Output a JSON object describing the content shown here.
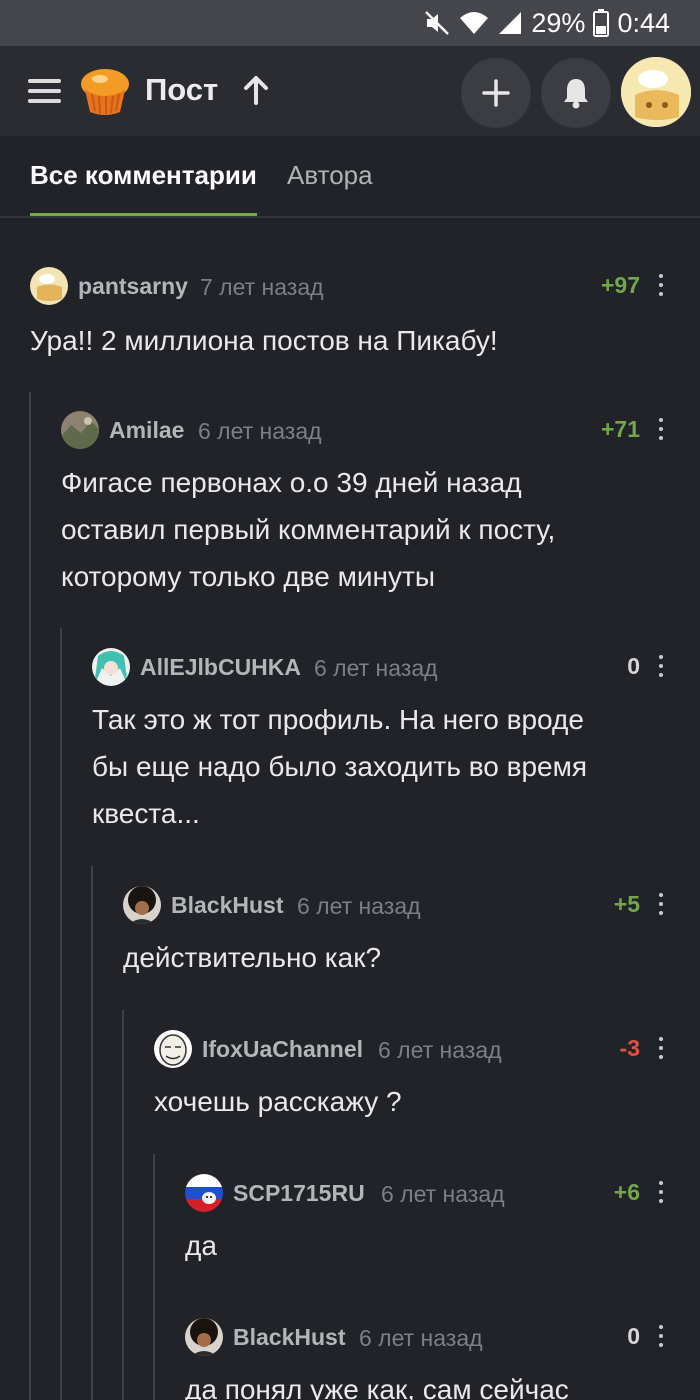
{
  "status_bar": {
    "battery": "29%",
    "time": "0:44"
  },
  "header": {
    "title": "Пост"
  },
  "tabs": [
    {
      "label": "Все комментарии"
    },
    {
      "label": "Автора"
    }
  ],
  "comments": [
    {
      "author": "pantsarny",
      "time": "7 лет назад",
      "rating": "+97",
      "text": "Ура!! 2 миллиона постов на Пикабу!"
    },
    {
      "author": "Amilae",
      "time": "6 лет назад",
      "rating": "+71",
      "text": "Фигасе первонах о.о 39 дней назад\nоставил первый комментарий к посту,\nкоторому только две минуты"
    },
    {
      "author": "AllEJlbCUHKA",
      "time": "6 лет назад",
      "rating": "0",
      "text": "Так это ж тот профиль. На него вроде\nбы еще надо было заходить во время\nквеста..."
    },
    {
      "author": "BlackHust",
      "time": "6 лет назад",
      "rating": "+5",
      "text": "действительно как?"
    },
    {
      "author": "IfoxUaChannel",
      "time": "6 лет назад",
      "rating": "-3",
      "text": "хочешь расскажу ?"
    },
    {
      "author": "SCP1715RU",
      "time": "6 лет назад",
      "rating": "+6",
      "text": "да"
    },
    {
      "author": "BlackHust",
      "time": "6 лет назад",
      "rating": "0",
      "text": "да понял уже как, сам сейчас"
    }
  ],
  "colors": {
    "positive": "#72a84a",
    "negative": "#e4523e",
    "accent": "#72a84a",
    "background": "#212328"
  }
}
